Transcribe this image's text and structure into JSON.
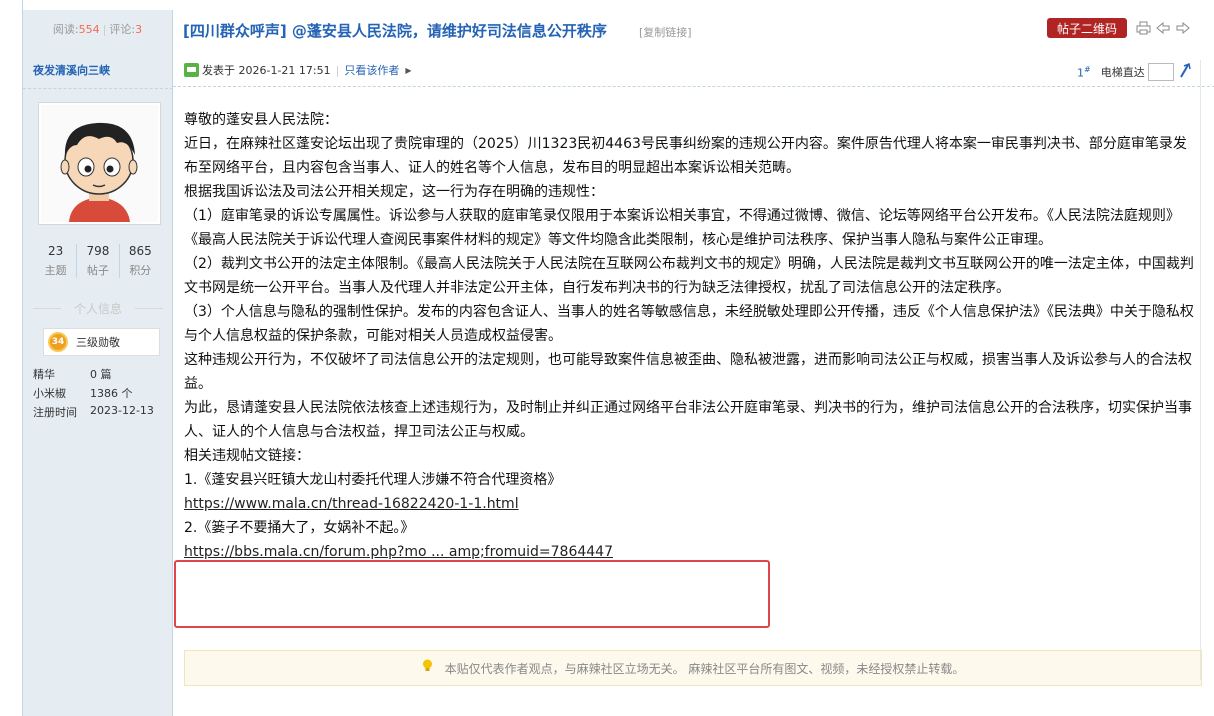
{
  "header": {
    "reads_label": "阅读:",
    "reads": "554",
    "replies_label": "评论:",
    "replies": "3",
    "title": "[四川群众呼声] @蓬安县人民法院，请维护好司法信息公开秩序",
    "copy_link": "[复制链接]",
    "qr_button": "帖子二维码",
    "icons": [
      "print-icon",
      "prev-icon",
      "next-icon"
    ]
  },
  "sidebar": {
    "author": "夜发清溪向三峡",
    "stats": [
      {
        "value": "23",
        "label": "主题"
      },
      {
        "value": "798",
        "label": "帖子"
      },
      {
        "value": "865",
        "label": "积分"
      }
    ],
    "personal_info": "个人信息",
    "medal_level": "34",
    "medal_label": "三级勋敬",
    "info": [
      {
        "key": "精华",
        "value": "0 篇"
      },
      {
        "key": "小米椒",
        "value": "1386 个"
      },
      {
        "key": "注册时间",
        "value": "2023-12-13"
      }
    ]
  },
  "post": {
    "posted_at": "发表于 2026-1-21 17:51",
    "only_author": "只看该作者",
    "floor": "1",
    "floor_sup": "#",
    "jump_label": "电梯直达",
    "paragraphs": [
      "尊敬的蓬安县人民法院：",
      "近日，在麻辣社区蓬安论坛出现了贵院审理的（2025）川1323民初4463号民事纠纷案的违规公开内容。案件原告代理人将本案一审民事判决书、部分庭审笔录发布至网络平台，且内容包含当事人、证人的姓名等个人信息，发布目的明显超出本案诉讼相关范畴。",
      "根据我国诉讼法及司法公开相关规定，这一行为存在明确的违规性：",
      "（1）庭审笔录的诉讼专属属性。诉讼参与人获取的庭审笔录仅限用于本案诉讼相关事宜，不得通过微博、微信、论坛等网络平台公开发布。《人民法院法庭规则》《最高人民法院关于诉讼代理人查阅民事案件材料的规定》等文件均隐含此类限制，核心是维护司法秩序、保护当事人隐私与案件公正审理。",
      "（2）裁判文书公开的法定主体限制。《最高人民法院关于人民法院在互联网公布裁判文书的规定》明确，人民法院是裁判文书互联网公开的唯一法定主体，中国裁判文书网是统一公开平台。当事人及代理人并非法定公开主体，自行发布判决书的行为缺乏法律授权，扰乱了司法信息公开的法定秩序。",
      "（3）个人信息与隐私的强制性保护。发布的内容包含证人、当事人的姓名等敏感信息，未经脱敏处理即公开传播，违反《个人信息保护法》《民法典》中关于隐私权与个人信息权益的保护条款，可能对相关人员造成权益侵害。",
      "这种违规公开行为，不仅破坏了司法信息公开的法定规则，也可能导致案件信息被歪曲、隐私被泄露，进而影响司法公正与权威，损害当事人及诉讼参与人的合法权益。",
      "为此，恳请蓬安县人民法院依法核查上述违规行为，及时制止并纠正通过网络平台非法公开庭审笔录、判决书的行为，维护司法信息公开的合法秩序，切实保护当事人、证人的个人信息与合法权益，捍卫司法公正与权威。",
      "相关违规帖文链接："
    ],
    "link1_title": "1.《蓬安县兴旺镇大龙山村委托代理人涉嫌不符合代理资格》",
    "link1_url": "https://www.mala.cn/thread-16822420-1-1.html",
    "link2_title": "2.《篓子不要捅大了，女娲补不起。》",
    "link2_url": "https://bbs.mala.cn/forum.php?mo ... amp;fromuid=7864447",
    "notice": "本贴仅代表作者观点，与麻辣社区立场无关。 麻辣社区平台所有图文、视频，未经授权禁止转载。"
  }
}
